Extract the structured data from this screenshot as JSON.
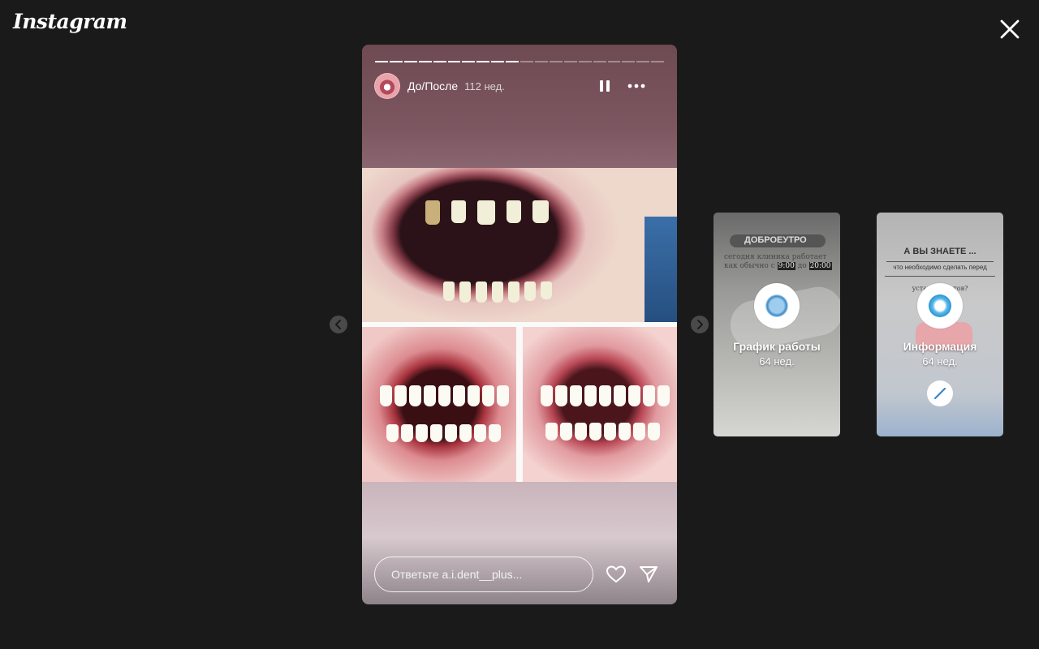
{
  "header": {
    "logo": "Instagram"
  },
  "story": {
    "title": "До/После",
    "time": "112 нед.",
    "progress": {
      "total": 20,
      "completed": 10
    },
    "reply_placeholder": "Ответьте a.i.dent__plus..."
  },
  "side_stories": [
    {
      "title": "График работы",
      "time": "64 нед.",
      "bg_title": "ДОБРОЕУТРО",
      "bg_line1": "сегодня клиника работает",
      "bg_line2": "как обычно с",
      "bg_time_from": "9:00",
      "bg_time_to": "20:00",
      "bg_line2_mid": "до"
    },
    {
      "title": "Информация",
      "time": "64 нед.",
      "bg_title": "А ВЫ ЗНАЕТЕ ...",
      "bg_line1": "что необходимо сделать перед",
      "bg_line2": "устан...   ...хетов?"
    }
  ],
  "icons": {
    "close": "close-icon",
    "pause": "pause-icon",
    "more": "more-options-icon",
    "like": "heart-icon",
    "share": "send-icon",
    "prev": "chevron-left-icon",
    "next": "chevron-right-icon"
  }
}
